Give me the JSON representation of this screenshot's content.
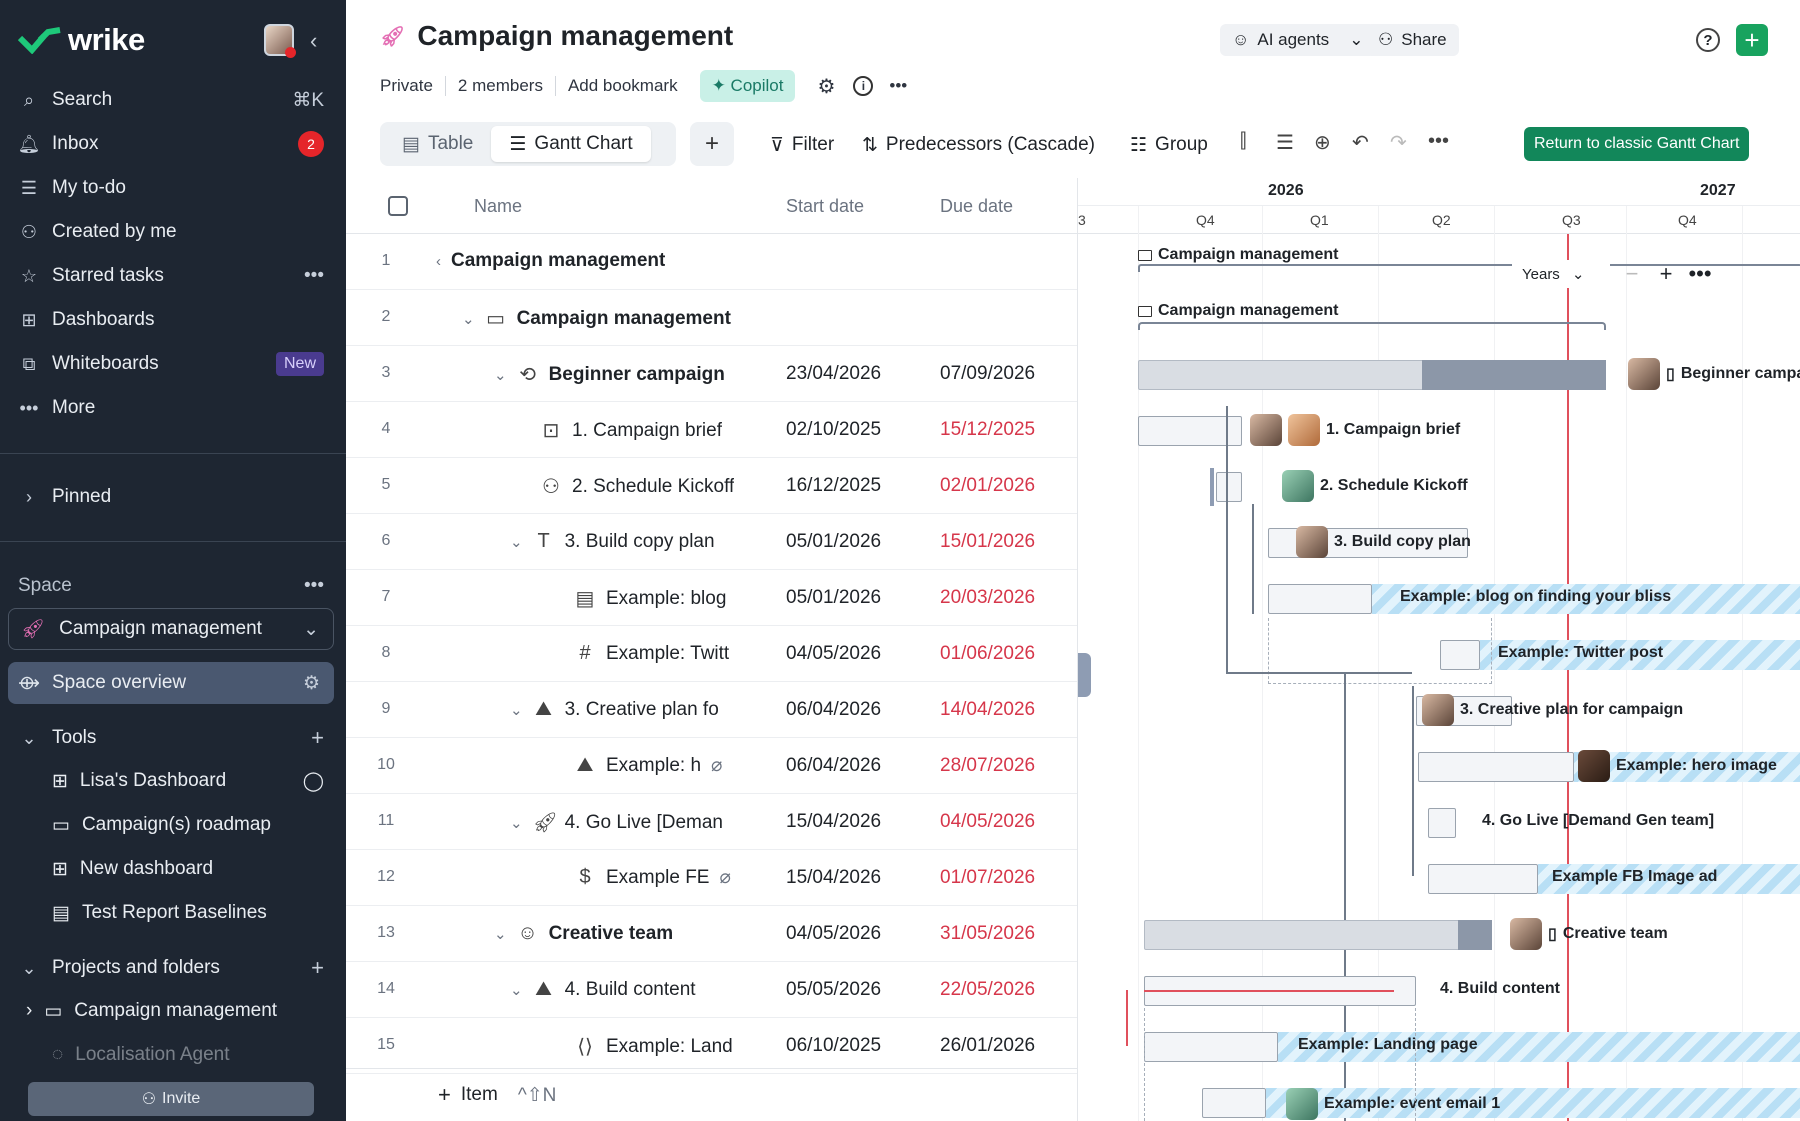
{
  "sidebar": {
    "brand": "wrike",
    "nav": [
      {
        "label": "Search",
        "shortcut": "⌘K"
      },
      {
        "label": "Inbox",
        "badge": "2"
      },
      {
        "label": "My to-do"
      },
      {
        "label": "Created by me"
      },
      {
        "label": "Starred tasks"
      },
      {
        "label": "Dashboards"
      },
      {
        "label": "Whiteboards",
        "badge": "New"
      },
      {
        "label": "More"
      }
    ],
    "pinned": "Pinned",
    "space_label": "Space",
    "space_selected": "Campaign management",
    "space_overview": "Space overview",
    "tools_label": "Tools",
    "tools": [
      "Lisa's Dashboard",
      "Campaign(s) roadmap",
      "New dashboard",
      "Test Report Baselines"
    ],
    "projects_label": "Projects and folders",
    "projects": [
      "Campaign management",
      "Localisation Agent"
    ],
    "invite": "Invite"
  },
  "header": {
    "title": "Campaign management",
    "meta": [
      "Private",
      "2 members",
      "Add bookmark"
    ],
    "copilot": "Copilot",
    "ai_agents": "AI agents",
    "share": "Share",
    "help": "?"
  },
  "toolbar": {
    "tabs": [
      "Table",
      "Gantt Chart"
    ],
    "filter": "Filter",
    "predecessors": "Predecessors (Cascade)",
    "group": "Group",
    "classic": "Return to classic Gantt Chart"
  },
  "table": {
    "columns": [
      "Name",
      "Start date",
      "Due date"
    ],
    "rows": [
      {
        "n": "1",
        "name": "Campaign management",
        "start": "",
        "due": ""
      },
      {
        "n": "2",
        "name": "Campaign management",
        "start": "",
        "due": ""
      },
      {
        "n": "3",
        "name": "Beginner campaign",
        "start": "23/04/2026",
        "due": "07/09/2026"
      },
      {
        "n": "4",
        "name": "1. Campaign brief",
        "start": "02/10/2025",
        "due": "15/12/2025"
      },
      {
        "n": "5",
        "name": "2. Schedule Kickoff",
        "start": "16/12/2025",
        "due": "02/01/2026"
      },
      {
        "n": "6",
        "name": "3. Build copy plan",
        "start": "05/01/2026",
        "due": "15/01/2026"
      },
      {
        "n": "7",
        "name": "Example: blog",
        "start": "05/01/2026",
        "due": "20/03/2026"
      },
      {
        "n": "8",
        "name": "Example: Twitt",
        "start": "04/05/2026",
        "due": "01/06/2026"
      },
      {
        "n": "9",
        "name": "3. Creative plan fo",
        "start": "06/04/2026",
        "due": "14/04/2026"
      },
      {
        "n": "10",
        "name": "Example: h",
        "start": "06/04/2026",
        "due": "28/07/2026"
      },
      {
        "n": "11",
        "name": "4. Go Live [Deman",
        "start": "15/04/2026",
        "due": "04/05/2026"
      },
      {
        "n": "12",
        "name": "Example FE",
        "start": "15/04/2026",
        "due": "01/07/2026"
      },
      {
        "n": "13",
        "name": "Creative team",
        "start": "04/05/2026",
        "due": "31/05/2026"
      },
      {
        "n": "14",
        "name": "4. Build content",
        "start": "05/05/2026",
        "due": "22/05/2026"
      },
      {
        "n": "15",
        "name": "Example: Land",
        "start": "06/10/2025",
        "due": "26/01/2026"
      }
    ],
    "add_item": "Item",
    "add_shortcut": "^⇧N"
  },
  "gantt": {
    "year_2026": "2026",
    "year_2027": "2027",
    "left_stub": "3",
    "quarters": [
      "Q4",
      "Q1",
      "Q2",
      "Q3",
      "Q4"
    ],
    "scale": "Years",
    "labels": [
      "Campaign management",
      "Campaign management",
      "Beginner campaign",
      "1. Campaign brief",
      "2. Schedule Kickoff",
      "3. Build copy plan",
      "Example: blog on finding your bliss",
      "Example: Twitter post",
      "3. Creative plan for campaign",
      "Example: hero image",
      "4. Go Live [Demand Gen team]",
      "Example FB Image ad",
      "Creative team",
      "4. Build content",
      "Example: Landing page",
      "Example: event email 1"
    ]
  }
}
